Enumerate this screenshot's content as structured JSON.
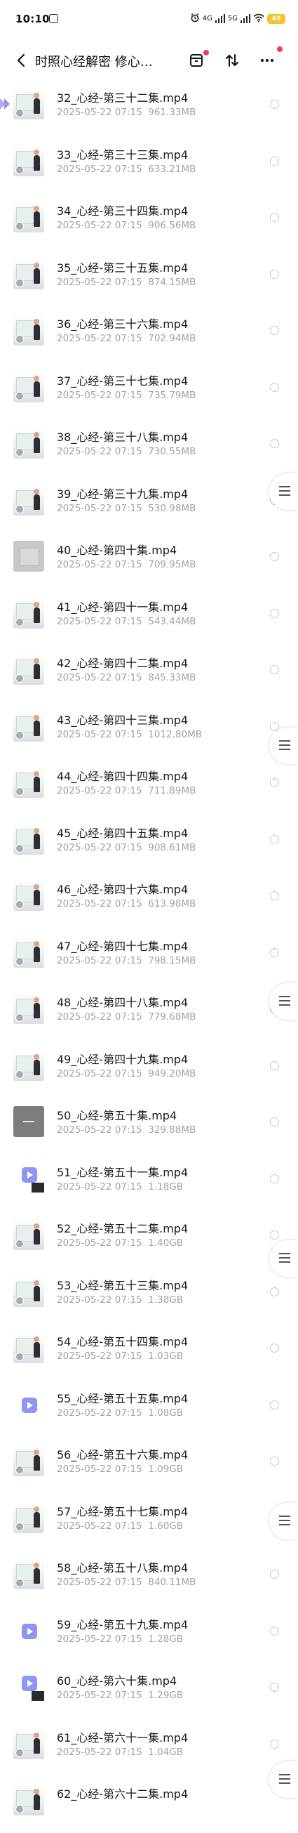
{
  "status": {
    "time": "10:10",
    "net1": "4G",
    "net2": "5G",
    "battery": "45"
  },
  "header": {
    "title": "时照心经解密 修心…"
  },
  "files": [
    {
      "name": "32_心经-第三十二集.mp4",
      "date": "2025-05-22  07:15",
      "size": "961.33MB",
      "thumb": "video"
    },
    {
      "name": "33_心经-第三十三集.mp4",
      "date": "2025-05-22  07:15",
      "size": "633.21MB",
      "thumb": "video"
    },
    {
      "name": "34_心经-第三十四集.mp4",
      "date": "2025-05-22  07:15",
      "size": "906.56MB",
      "thumb": "video"
    },
    {
      "name": "35_心经-第三十五集.mp4",
      "date": "2025-05-22  07:15",
      "size": "874.15MB",
      "thumb": "video"
    },
    {
      "name": "36_心经-第三十六集.mp4",
      "date": "2025-05-22  07:15",
      "size": "702.94MB",
      "thumb": "video"
    },
    {
      "name": "37_心经-第三十七集.mp4",
      "date": "2025-05-22  07:15",
      "size": "735.79MB",
      "thumb": "video"
    },
    {
      "name": "38_心经-第三十八集.mp4",
      "date": "2025-05-22  07:15",
      "size": "730.55MB",
      "thumb": "video"
    },
    {
      "name": "39_心经-第三十九集.mp4",
      "date": "2025-05-22  07:15",
      "size": "530.98MB",
      "thumb": "video"
    },
    {
      "name": "40_心经-第四十集.mp4",
      "date": "2025-05-22  07:15",
      "size": "709.95MB",
      "thumb": "doc"
    },
    {
      "name": "41_心经-第四十一集.mp4",
      "date": "2025-05-22  07:15",
      "size": "543.44MB",
      "thumb": "video"
    },
    {
      "name": "42_心经-第四十二集.mp4",
      "date": "2025-05-22  07:15",
      "size": "845.33MB",
      "thumb": "video"
    },
    {
      "name": "43_心经-第四十三集.mp4",
      "date": "2025-05-22  07:15",
      "size": "1012.80MB",
      "thumb": "video"
    },
    {
      "name": "44_心经-第四十四集.mp4",
      "date": "2025-05-22  07:15",
      "size": "711.89MB",
      "thumb": "video"
    },
    {
      "name": "45_心经-第四十五集.mp4",
      "date": "2025-05-22  07:15",
      "size": "908.61MB",
      "thumb": "video"
    },
    {
      "name": "46_心经-第四十六集.mp4",
      "date": "2025-05-22  07:15",
      "size": "613.98MB",
      "thumb": "video"
    },
    {
      "name": "47_心经-第四十七集.mp4",
      "date": "2025-05-22  07:15",
      "size": "798.15MB",
      "thumb": "video"
    },
    {
      "name": "48_心经-第四十八集.mp4",
      "date": "2025-05-22  07:15",
      "size": "779.68MB",
      "thumb": "video"
    },
    {
      "name": "49_心经-第四十九集.mp4",
      "date": "2025-05-22  07:15",
      "size": "949.20MB",
      "thumb": "video"
    },
    {
      "name": "50_心经-第五十集.mp4",
      "date": "2025-05-22  07:15",
      "size": "329.88MB",
      "thumb": "gray"
    },
    {
      "name": "51_心经-第五十一集.mp4",
      "date": "2025-05-22  07:15",
      "size": "1.18GB",
      "thumb": "icon-cover"
    },
    {
      "name": "52_心经-第五十二集.mp4",
      "date": "2025-05-22  07:15",
      "size": "1.40GB",
      "thumb": "video"
    },
    {
      "name": "53_心经-第五十三集.mp4",
      "date": "2025-05-22  07:15",
      "size": "1.38GB",
      "thumb": "video"
    },
    {
      "name": "54_心经-第五十四集.mp4",
      "date": "2025-05-22  07:15",
      "size": "1.03GB",
      "thumb": "video"
    },
    {
      "name": "55_心经-第五十五集.mp4",
      "date": "2025-05-22  07:15",
      "size": "1.08GB",
      "thumb": "icon"
    },
    {
      "name": "56_心经-第五十六集.mp4",
      "date": "2025-05-22  07:15",
      "size": "1.09GB",
      "thumb": "video"
    },
    {
      "name": "57_心经-第五十七集.mp4",
      "date": "2025-05-22  07:15",
      "size": "1.60GB",
      "thumb": "video"
    },
    {
      "name": "58_心经-第五十八集.mp4",
      "date": "2025-05-22  07:15",
      "size": "840.11MB",
      "thumb": "video"
    },
    {
      "name": "59_心经-第五十九集.mp4",
      "date": "2025-05-22  07:15",
      "size": "1.28GB",
      "thumb": "icon"
    },
    {
      "name": "60_心经-第六十集.mp4",
      "date": "2025-05-22  07:15",
      "size": "1.29GB",
      "thumb": "icon-cover"
    },
    {
      "name": "61_心经-第六十一集.mp4",
      "date": "2025-05-22  07:15",
      "size": "1.04GB",
      "thumb": "video"
    },
    {
      "name": "62_心经-第六十二集.mp4",
      "date": "",
      "size": "",
      "thumb": "video"
    }
  ],
  "colors": {
    "accent": "#8f95f2",
    "badge": "#ef3b5d",
    "meta_text": "#a3a3a3",
    "battery": "#f4c430"
  }
}
